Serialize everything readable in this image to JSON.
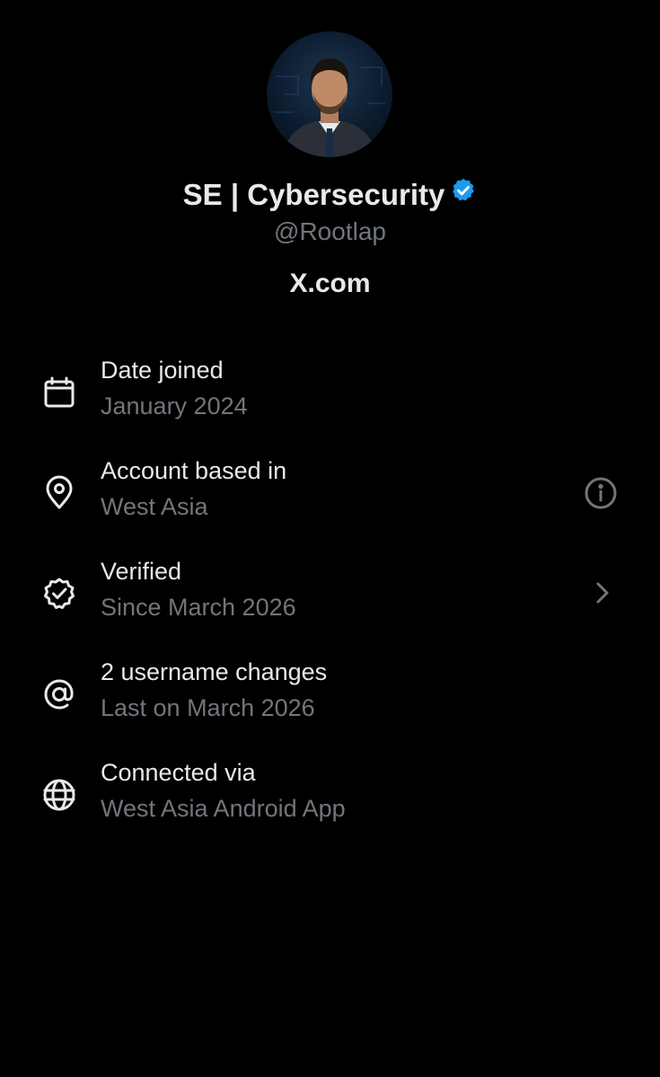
{
  "profile": {
    "display_name": "SE | Cybersecurity",
    "handle": "@Rootlap",
    "site": "X.com",
    "verified_badge_color": "#1d9bf0"
  },
  "details": [
    {
      "icon": "calendar-icon",
      "title": "Date joined",
      "subtitle": "January 2024"
    },
    {
      "icon": "location-pin-icon",
      "title": "Account based in",
      "subtitle": "West Asia",
      "trailing_icon": "info-icon"
    },
    {
      "icon": "verified-check-icon",
      "title": "Verified",
      "subtitle": "Since March 2026",
      "trailing_icon": "chevron-right-icon"
    },
    {
      "icon": "at-sign-icon",
      "title": "2 username changes",
      "subtitle": "Last on March 2026"
    },
    {
      "icon": "globe-icon",
      "title": "Connected via",
      "subtitle": "West Asia Android App"
    }
  ],
  "colors": {
    "background": "#000000",
    "primary_text": "#e7e9ea",
    "secondary_text": "#71767b"
  }
}
